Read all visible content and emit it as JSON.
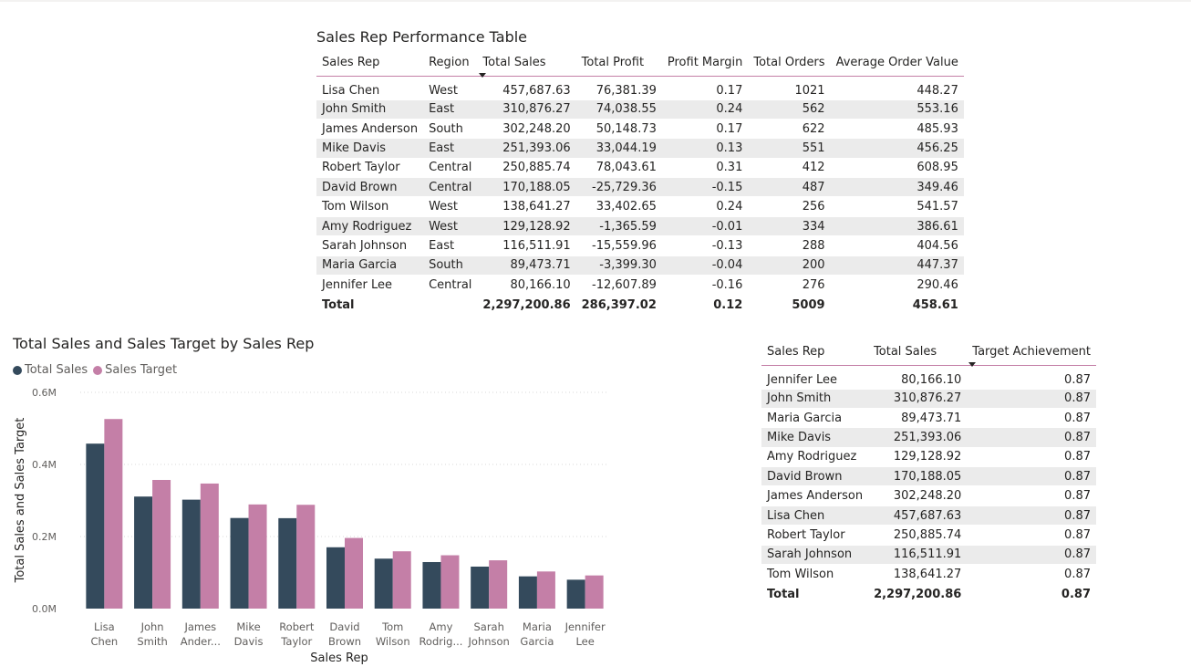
{
  "performance_table": {
    "title": "Sales Rep Performance Table",
    "columns": [
      "Sales Rep",
      "Region",
      "Total Sales",
      "Total Profit",
      "Profit Margin",
      "Total Orders",
      "Average Order Value"
    ],
    "rows": [
      [
        "Lisa Chen",
        "West",
        "457,687.63",
        "76,381.39",
        "0.17",
        "1021",
        "448.27"
      ],
      [
        "John Smith",
        "East",
        "310,876.27",
        "74,038.55",
        "0.24",
        "562",
        "553.16"
      ],
      [
        "James Anderson",
        "South",
        "302,248.20",
        "50,148.73",
        "0.17",
        "622",
        "485.93"
      ],
      [
        "Mike Davis",
        "East",
        "251,393.06",
        "33,044.19",
        "0.13",
        "551",
        "456.25"
      ],
      [
        "Robert Taylor",
        "Central",
        "250,885.74",
        "78,043.61",
        "0.31",
        "412",
        "608.95"
      ],
      [
        "David Brown",
        "Central",
        "170,188.05",
        "-25,729.36",
        "-0.15",
        "487",
        "349.46"
      ],
      [
        "Tom Wilson",
        "West",
        "138,641.27",
        "33,402.65",
        "0.24",
        "256",
        "541.57"
      ],
      [
        "Amy Rodriguez",
        "West",
        "129,128.92",
        "-1,365.59",
        "-0.01",
        "334",
        "386.61"
      ],
      [
        "Sarah Johnson",
        "East",
        "116,511.91",
        "-15,559.96",
        "-0.13",
        "288",
        "404.56"
      ],
      [
        "Maria Garcia",
        "South",
        "89,473.71",
        "-3,399.30",
        "-0.04",
        "200",
        "447.37"
      ],
      [
        "Jennifer Lee",
        "Central",
        "80,166.10",
        "-12,607.89",
        "-0.16",
        "276",
        "290.46"
      ]
    ],
    "total": [
      "Total",
      "",
      "2,297,200.86",
      "286,397.02",
      "0.12",
      "5009",
      "458.61"
    ]
  },
  "target_table": {
    "columns": [
      "Sales Rep",
      "Total Sales",
      "Target Achievement"
    ],
    "rows": [
      [
        "Jennifer Lee",
        "80,166.10",
        "0.87"
      ],
      [
        "John Smith",
        "310,876.27",
        "0.87"
      ],
      [
        "Maria Garcia",
        "89,473.71",
        "0.87"
      ],
      [
        "Mike Davis",
        "251,393.06",
        "0.87"
      ],
      [
        "Amy Rodriguez",
        "129,128.92",
        "0.87"
      ],
      [
        "David Brown",
        "170,188.05",
        "0.87"
      ],
      [
        "James Anderson",
        "302,248.20",
        "0.87"
      ],
      [
        "Lisa Chen",
        "457,687.63",
        "0.87"
      ],
      [
        "Robert Taylor",
        "250,885.74",
        "0.87"
      ],
      [
        "Sarah Johnson",
        "116,511.91",
        "0.87"
      ],
      [
        "Tom Wilson",
        "138,641.27",
        "0.87"
      ]
    ],
    "total": [
      "Total",
      "2,297,200.86",
      "0.87"
    ]
  },
  "chart_data": {
    "type": "bar",
    "title": "Total Sales and Sales Target by Sales Rep",
    "xlabel": "Sales Rep",
    "ylabel": "Total Sales and Sales Target",
    "categories": [
      [
        "Lisa",
        "Chen"
      ],
      [
        "John",
        "Smith"
      ],
      [
        "James",
        "Ander..."
      ],
      [
        "Mike",
        "Davis"
      ],
      [
        "Robert",
        "Taylor"
      ],
      [
        "David",
        "Brown"
      ],
      [
        "Tom",
        "Wilson"
      ],
      [
        "Amy",
        "Rodrig..."
      ],
      [
        "Sarah",
        "Johnson"
      ],
      [
        "Maria",
        "Garcia"
      ],
      [
        "Jennifer",
        "Lee"
      ]
    ],
    "series": [
      {
        "name": "Total Sales",
        "color": "#344a5c",
        "values": [
          457687.63,
          310876.27,
          302248.2,
          251393.06,
          250885.74,
          170188.05,
          138641.27,
          129128.92,
          116511.91,
          89473.71,
          80166.1
        ]
      },
      {
        "name": "Sales Target",
        "color": "#c47fa7",
        "values": [
          526000,
          357000,
          347000,
          289000,
          288000,
          196000,
          159000,
          148000,
          134000,
          103000,
          92000
        ]
      }
    ],
    "ylim": [
      0,
      600000
    ],
    "yticks": [
      0,
      200000,
      400000,
      600000
    ],
    "ytick_labels": [
      "0.0M",
      "0.2M",
      "0.4M",
      "0.6M"
    ],
    "grid": true,
    "legend": "top-left"
  }
}
